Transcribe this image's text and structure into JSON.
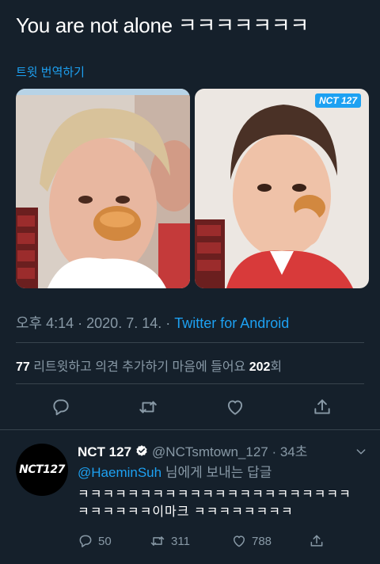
{
  "tweet": {
    "text": "You are not alone ㅋㅋㅋㅋㅋㅋㅋ",
    "translate_label": "트윗 번역하기",
    "timestamp": "오후 4:14 · 2020. 7. 14. · ",
    "source": "Twitter for Android"
  },
  "media": {
    "right_watermark": "NCT 127"
  },
  "stats": {
    "retweets_count": "77",
    "retweets_label": " 리트윗하고 의견 추가하기  마음에 들어요 ",
    "likes_count": "202",
    "likes_suffix": "회"
  },
  "actions": [
    "reply-icon",
    "retweet-icon",
    "like-icon",
    "share-icon"
  ],
  "reply": {
    "avatar_text": "NCT127",
    "name": "NCT 127",
    "handle_time": "@NCTsmtown_127 · 34초",
    "mention": "@HaeminSuh",
    "reply_to_suffix": " 님에게 보내는 답글",
    "body": "ㅋㅋㅋㅋㅋㅋㅋㅋㅋㅋㅋㅋㅋㅋㅋㅋㅋㅋㅋㅋㅋㅋㅋㅋㅋㅋㅋㅋ이마크 ㅋㅋㅋㅋㅋㅋㅋㅋ",
    "reply_count": "50",
    "retweet_count": "311",
    "like_count": "788"
  },
  "colors": {
    "background": "#15202b",
    "accent": "#1da1f2",
    "muted": "#8899a6"
  }
}
